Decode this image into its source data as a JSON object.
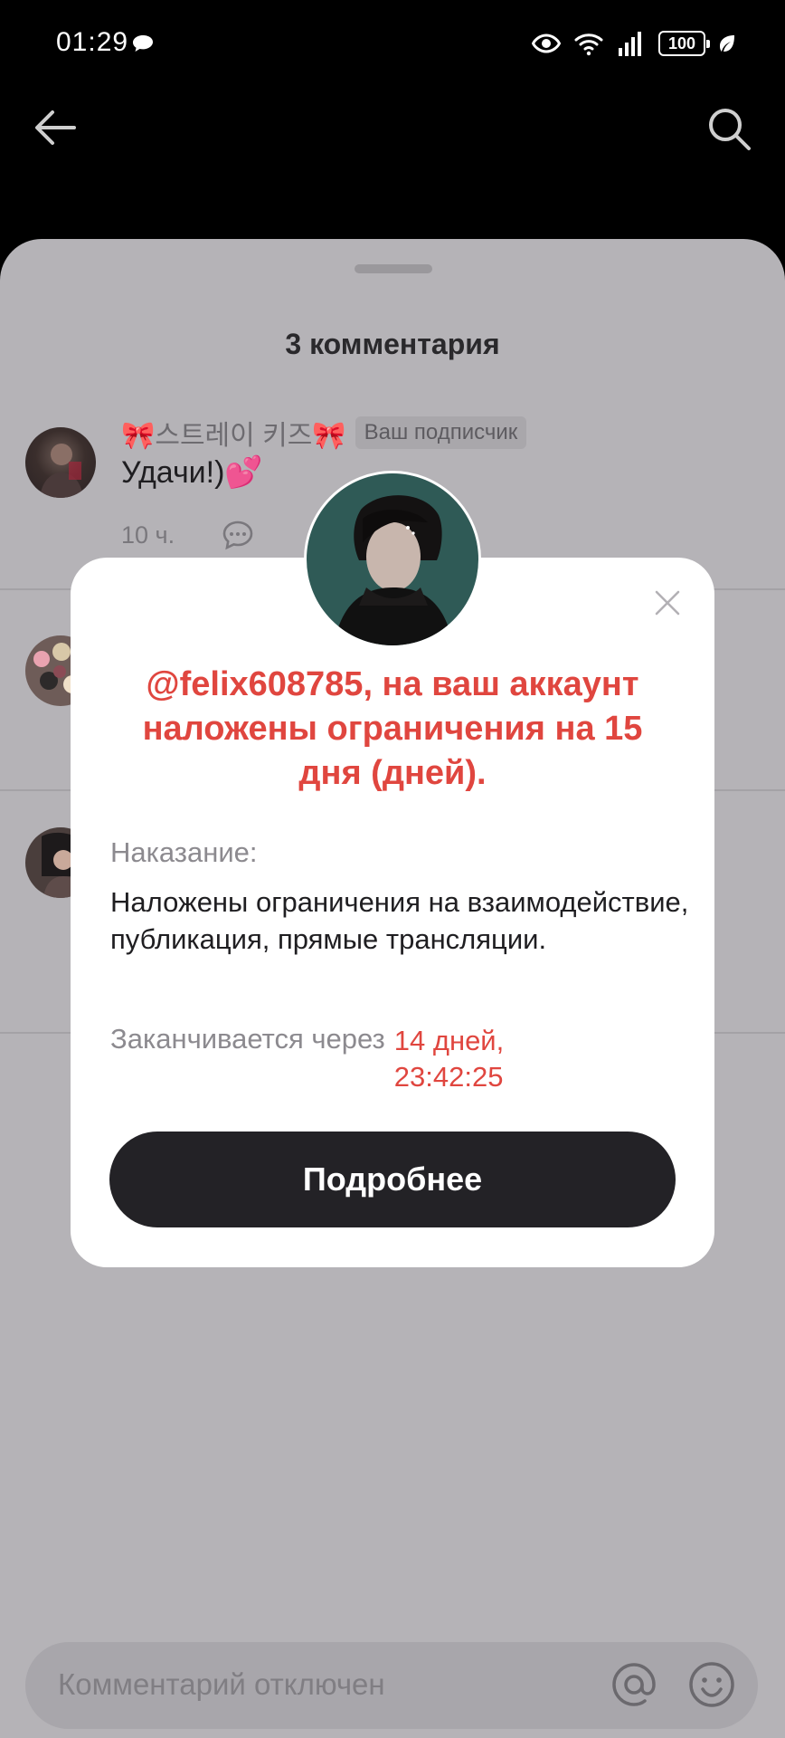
{
  "status_bar": {
    "time": "01:29",
    "battery": "100",
    "icons": [
      "chat-bubble-icon",
      "eye-icon",
      "wifi-icon",
      "signal-icon",
      "battery-icon",
      "leaf-icon"
    ]
  },
  "nav": {
    "back_icon": "arrow-left-icon",
    "search_icon": "search-icon"
  },
  "comments_sheet": {
    "title": "3 комментария",
    "comments": [
      {
        "author": "🎀스트레이 키즈🎀",
        "badge": "Ваш подписчик",
        "text": "Удачи!)💕",
        "time": "10 ч."
      },
      {
        "author": "",
        "badge": "",
        "text": "",
        "time": ""
      },
      {
        "author": "",
        "badge": "",
        "text": "",
        "time": ""
      }
    ],
    "input_placeholder": "Комментарий отключен"
  },
  "modal": {
    "title": "@felix608785, на ваш аккаунт наложены ограничения на 15 дня (дней).",
    "penalty_label": "Наказание:",
    "penalty_text": "Наложены ограничения на взаимодействие, публикация, прямые трансляции.",
    "ends_label": "Заканчивается через",
    "ends_value": "14 дней, 23:42:25",
    "details_button": "Подробнее"
  },
  "colors": {
    "accent_red": "#e0463f",
    "button_dark": "#232226",
    "dim_overlay": "#b5b3b7"
  }
}
